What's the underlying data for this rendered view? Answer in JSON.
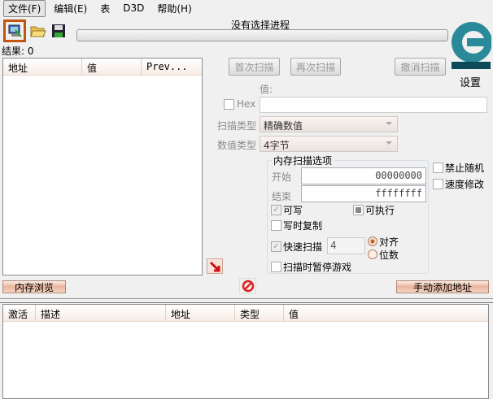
{
  "menu": {
    "file": "文件(F)",
    "edit": "编辑(E)",
    "table": "表",
    "d3d": "D3D",
    "help": "帮助(H)"
  },
  "title": "没有选择进程",
  "settings_label": "设置",
  "logo_text": "Cheat Engine",
  "results_label": "结果: 0",
  "results_columns": [
    "地址",
    "值",
    "Prev..."
  ],
  "buttons": {
    "first_scan": "首次扫描",
    "next_scan": "再次扫描",
    "undo_scan": "撤消扫描",
    "memory_view": "内存浏览",
    "add_address": "手动添加地址"
  },
  "value_label": "值:",
  "hex_label": "Hex",
  "value_input": "",
  "scan_type_label": "扫描类型",
  "scan_type_value": "精确数值",
  "value_type_label": "数值类型",
  "value_type_value": "4字节",
  "mem_options": {
    "title": "内存扫描选项",
    "start_label": "开始",
    "start_value": "00000000",
    "end_label": "结束",
    "end_value": "ffffffff",
    "writable": "可写",
    "executable": "可执行",
    "copy_on_write": "写时复制",
    "fast_scan": "快速扫描",
    "fast_scan_value": "4",
    "align": "对齐",
    "last_digits": "位数",
    "pause_game": "扫描时暂停游戏"
  },
  "disable_random": "禁止随机",
  "speedhack": "速度修改",
  "address_columns": [
    "激活",
    "描述",
    "地址",
    "类型",
    "值"
  ]
}
